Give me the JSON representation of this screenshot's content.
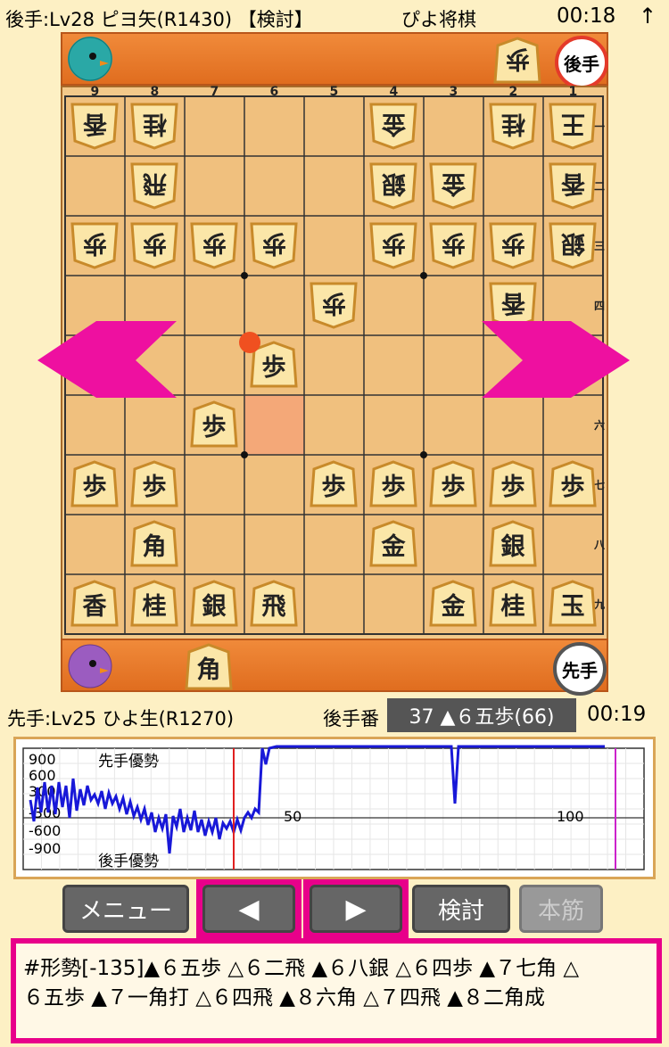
{
  "top": {
    "gote_player": "後手:Lv28 ピヨ矢(R1430) 【検討】",
    "app_title": "ぴよ将棋",
    "gote_time": "00:18",
    "menu_arrow": "↑"
  },
  "gote_hand": {
    "pieces": [
      "歩"
    ],
    "badge": "後手"
  },
  "sente_hand": {
    "pieces": [
      "角"
    ],
    "badge": "先手"
  },
  "board": {
    "file_labels": [
      "9",
      "8",
      "7",
      "6",
      "5",
      "4",
      "3",
      "2",
      "1"
    ],
    "rank_labels": [
      "一",
      "二",
      "三",
      "四",
      "五",
      "六",
      "七",
      "八",
      "九"
    ],
    "pieces": [
      {
        "f": 9,
        "r": 1,
        "ch": "香",
        "side": "gote"
      },
      {
        "f": 8,
        "r": 1,
        "ch": "桂",
        "side": "gote"
      },
      {
        "f": 4,
        "r": 1,
        "ch": "金",
        "side": "gote"
      },
      {
        "f": 2,
        "r": 1,
        "ch": "桂",
        "side": "gote"
      },
      {
        "f": 1,
        "r": 1,
        "ch": "王",
        "side": "gote"
      },
      {
        "f": 8,
        "r": 2,
        "ch": "飛",
        "side": "gote"
      },
      {
        "f": 4,
        "r": 2,
        "ch": "銀",
        "side": "gote"
      },
      {
        "f": 3,
        "r": 2,
        "ch": "金",
        "side": "gote"
      },
      {
        "f": 1,
        "r": 2,
        "ch": "香",
        "side": "gote"
      },
      {
        "f": 9,
        "r": 3,
        "ch": "歩",
        "side": "gote"
      },
      {
        "f": 8,
        "r": 3,
        "ch": "歩",
        "side": "gote"
      },
      {
        "f": 7,
        "r": 3,
        "ch": "歩",
        "side": "gote"
      },
      {
        "f": 6,
        "r": 3,
        "ch": "歩",
        "side": "gote"
      },
      {
        "f": 4,
        "r": 3,
        "ch": "歩",
        "side": "gote"
      },
      {
        "f": 3,
        "r": 3,
        "ch": "歩",
        "side": "gote"
      },
      {
        "f": 2,
        "r": 3,
        "ch": "歩",
        "side": "gote"
      },
      {
        "f": 1,
        "r": 3,
        "ch": "銀",
        "side": "gote"
      },
      {
        "f": 5,
        "r": 4,
        "ch": "歩",
        "side": "gote"
      },
      {
        "f": 2,
        "r": 4,
        "ch": "香",
        "side": "gote"
      },
      {
        "f": 6,
        "r": 5,
        "ch": "歩",
        "side": "sente"
      },
      {
        "f": 7,
        "r": 6,
        "ch": "歩",
        "side": "sente"
      },
      {
        "f": 9,
        "r": 7,
        "ch": "歩",
        "side": "sente"
      },
      {
        "f": 8,
        "r": 7,
        "ch": "歩",
        "side": "sente"
      },
      {
        "f": 5,
        "r": 7,
        "ch": "歩",
        "side": "sente"
      },
      {
        "f": 4,
        "r": 7,
        "ch": "歩",
        "side": "sente"
      },
      {
        "f": 3,
        "r": 7,
        "ch": "歩",
        "side": "sente"
      },
      {
        "f": 2,
        "r": 7,
        "ch": "歩",
        "side": "sente"
      },
      {
        "f": 1,
        "r": 7,
        "ch": "歩",
        "side": "sente"
      },
      {
        "f": 8,
        "r": 8,
        "ch": "角",
        "side": "sente"
      },
      {
        "f": 4,
        "r": 8,
        "ch": "金",
        "side": "sente"
      },
      {
        "f": 2,
        "r": 8,
        "ch": "銀",
        "side": "sente"
      },
      {
        "f": 9,
        "r": 9,
        "ch": "香",
        "side": "sente"
      },
      {
        "f": 8,
        "r": 9,
        "ch": "桂",
        "side": "sente"
      },
      {
        "f": 7,
        "r": 9,
        "ch": "銀",
        "side": "sente"
      },
      {
        "f": 6,
        "r": 9,
        "ch": "飛",
        "side": "sente"
      },
      {
        "f": 3,
        "r": 9,
        "ch": "金",
        "side": "sente"
      },
      {
        "f": 2,
        "r": 9,
        "ch": "桂",
        "side": "sente"
      },
      {
        "f": 1,
        "r": 9,
        "ch": "玉",
        "side": "sente"
      }
    ],
    "last_move_from": {
      "f": 6,
      "r": 6
    },
    "last_move_to": {
      "f": 6,
      "r": 5
    },
    "star_points": [
      {
        "f": 6,
        "r": 3
      },
      {
        "f": 3,
        "r": 3
      },
      {
        "f": 6,
        "r": 6
      },
      {
        "f": 3,
        "r": 6
      }
    ]
  },
  "status": {
    "sente_player": "先手:Lv25 ひよ生(R1270)",
    "turn": "後手番",
    "move": "37 ▲６五歩(66)",
    "sente_time": "00:19"
  },
  "graph": {
    "y_labels": [
      "900",
      "600",
      "300",
      "-300",
      "-600",
      "-900"
    ],
    "x_labels": [
      "50",
      "100"
    ],
    "sente_label": "先手優勢",
    "gote_label": "後手優勢",
    "current_move": 37,
    "colors": {
      "line": "#1818d8",
      "current": "#e02020",
      "end": "#cc22cc"
    }
  },
  "buttons": {
    "menu": "メニュー",
    "prev": "◀",
    "next": "▶",
    "kento": "検討",
    "honsuji": "本筋"
  },
  "kifu": {
    "line1": "#形勢[-135]▲６五歩 △６二飛 ▲６八銀 △６四歩 ▲７七角 △",
    "line2": "６五歩 ▲７一角打 △６四飛 ▲８六角 △７四飛 ▲８二角成"
  }
}
